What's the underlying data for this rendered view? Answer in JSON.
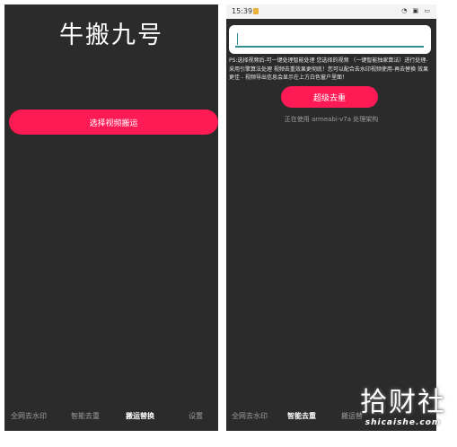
{
  "left_screen": {
    "app_title": "牛搬九号",
    "select_button_label": "选择视频搬运",
    "nav": [
      {
        "label": "全网去水印",
        "active": false
      },
      {
        "label": "智能去重",
        "active": false
      },
      {
        "label": "搬运替换",
        "active": true
      },
      {
        "label": "设置",
        "active": false
      }
    ]
  },
  "right_screen": {
    "status_time": "15:39",
    "status_icons": "◔ ▣ ▭",
    "input_value": "",
    "ps_text": "PS:选择视频后-可一键处理智能处理 您选择的视频 （一键智能独家算法）进行处理-采用引擎算法处理 视频去重效果更彻底！您可以配合去水印视频使用-再去替换 效果更佳 - 视频导出信息会显示在上方白色窗户里面！",
    "dedupe_button_label": "超级去重",
    "arch_text": "正在使用 armeabi-v7a 处理架构",
    "nav": [
      {
        "label": "全网去水印",
        "active": false
      },
      {
        "label": "智能去重",
        "active": true
      },
      {
        "label": "搬运替",
        "active": false
      }
    ]
  },
  "watermark": {
    "main": "拾财社",
    "sub": "shicaishe.com"
  },
  "colors": {
    "accent": "#fe1a55",
    "background": "#2b2b2b"
  }
}
